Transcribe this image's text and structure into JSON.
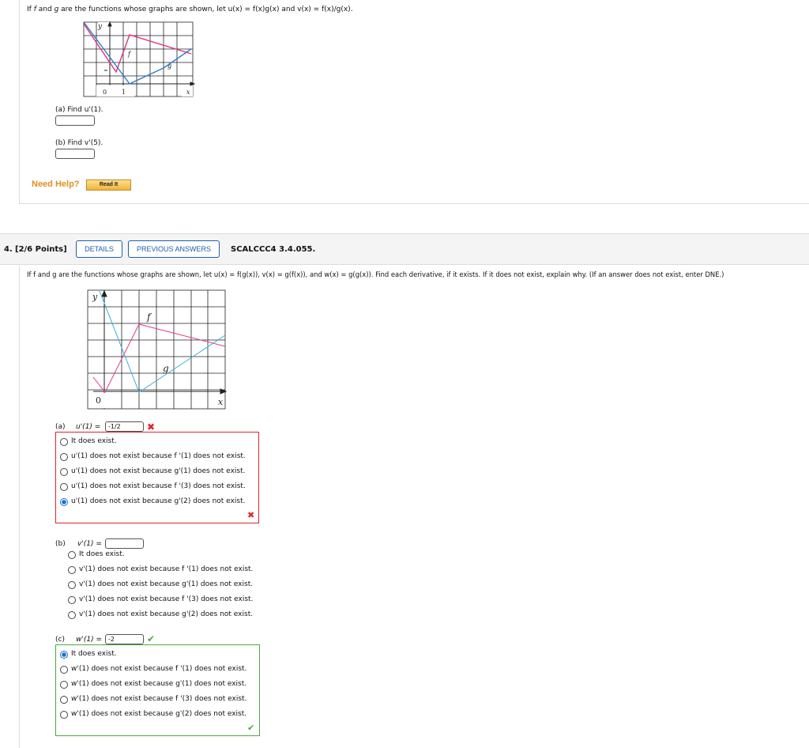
{
  "q3": {
    "prompt_pre": "If",
    "prompt_f": "f",
    "prompt_and": "and",
    "prompt_g": "g",
    "prompt_post": "are the functions whose graphs are shown, let u(x) = f(x)g(x) and v(x) = f(x)/g(x).",
    "graph_labels": {
      "y": "y",
      "f": "f",
      "g": "g",
      "zero": "0",
      "one": "1",
      "x": "x"
    },
    "part_a": "(a) Find u'(1).",
    "part_b": "(b) Find v'(5).",
    "need_help": "Need Help?",
    "read_it": "Read It"
  },
  "q4": {
    "number": "4.",
    "points": "[2/6 Points]",
    "details_btn": "DETAILS",
    "prev_btn": "PREVIOUS ANSWERS",
    "code": "SCALCCC4 3.4.055.",
    "prompt": "If f and g are the functions whose graphs are shown, let u(x) = f(g(x)), v(x) = g(f(x)), and w(x) = g(g(x)). Find each derivative, if it exists. If it does not exist, explain why. (If an answer does not exist, enter DNE.)",
    "graph_labels": {
      "y": "y",
      "f": "f",
      "g": "g",
      "zero": "0",
      "x": "x"
    },
    "part_a": {
      "label": "(a)",
      "expr": "u'(1) =",
      "value": "-1/2",
      "status": "incorrect",
      "options": [
        "It does exist.",
        "u'(1) does not exist because f '(1) does not exist.",
        "u'(1) does not exist because g'(1) does not exist.",
        "u'(1) does not exist because f '(3) does not exist.",
        "u'(1) does not exist because g'(2) does not exist."
      ],
      "selected": 4
    },
    "part_b": {
      "label": "(b)",
      "expr": "v'(1) =",
      "value": "",
      "options": [
        "It does exist.",
        "v'(1) does not exist because f '(1) does not exist.",
        "v'(1) does not exist because g'(1) does not exist.",
        "v'(1) does not exist because f '(3) does not exist.",
        "v'(1) does not exist because g'(2) does not exist."
      ],
      "selected": -1
    },
    "part_c": {
      "label": "(c)",
      "expr": "w'(1) =",
      "value": "-2",
      "status": "correct",
      "options": [
        "It does exist.",
        "w'(1) does not exist because f '(1) does not exist.",
        "w'(1) does not exist because g'(1) does not exist.",
        "w'(1) does not exist because f '(3) does not exist.",
        "w'(1) does not exist because g'(2) does not exist."
      ],
      "selected": 0
    }
  },
  "colors": {
    "f_line_q3": "#e0307a",
    "g_line_q3": "#2f7bc4",
    "f_line_q4": "#e03c8c",
    "g_line_q4": "#3aaedc",
    "incorrect": "#e0242a",
    "correct": "#4caa3a",
    "link": "#1d5fa8",
    "need_help": "#e0901a",
    "radio_selected": "#1a6fd1"
  }
}
